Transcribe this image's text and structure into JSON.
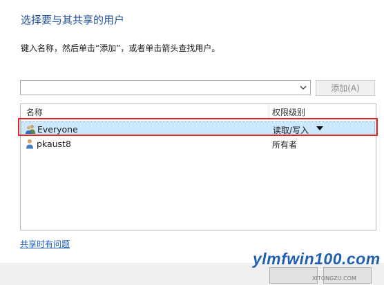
{
  "title": "选择要与其共享的用户",
  "instruction": "键入名称，然后单击“添加”，或者单击箭头查找用户。",
  "combo": {
    "value": ""
  },
  "add_button": {
    "label": "添加(A)"
  },
  "list": {
    "columns": {
      "name": "名称",
      "permission": "权限级别"
    },
    "rows": [
      {
        "name": "Everyone",
        "permission": "读取/写入",
        "icon": "group-users-icon",
        "selected": true
      },
      {
        "name": "pkaust8",
        "permission": "所有者",
        "icon": "user-icon",
        "selected": false
      }
    ]
  },
  "help_link": "共享时有问题",
  "watermark": {
    "text": "ylmfwin100.com",
    "small_text": "XITONGZU.COM"
  },
  "colors": {
    "title": "#1f4e9b",
    "selection": "#cce8ff",
    "highlight": "#e2242b",
    "link": "#1a5dbd"
  }
}
